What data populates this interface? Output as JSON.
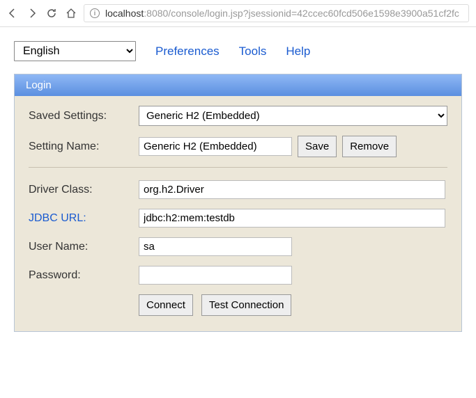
{
  "browser": {
    "host": "localhost",
    "port_path": ":8080/console/login.jsp?jsessionid=42ccec60fcd506e1598e3900a51cf2fc"
  },
  "top_menu": {
    "language": "English",
    "preferences": "Preferences",
    "tools": "Tools",
    "help": "Help"
  },
  "panel": {
    "title": "Login"
  },
  "form": {
    "labels": {
      "saved_settings": "Saved Settings:",
      "setting_name": "Setting Name:",
      "driver_class": "Driver Class:",
      "jdbc_url": "JDBC URL:",
      "user_name": "User Name:",
      "password": "Password:"
    },
    "values": {
      "saved_settings": "Generic H2 (Embedded)",
      "setting_name": "Generic H2 (Embedded)",
      "driver_class": "org.h2.Driver",
      "jdbc_url": "jdbc:h2:mem:testdb",
      "user_name": "sa",
      "password": ""
    },
    "buttons": {
      "save": "Save",
      "remove": "Remove",
      "connect": "Connect",
      "test": "Test Connection"
    }
  }
}
